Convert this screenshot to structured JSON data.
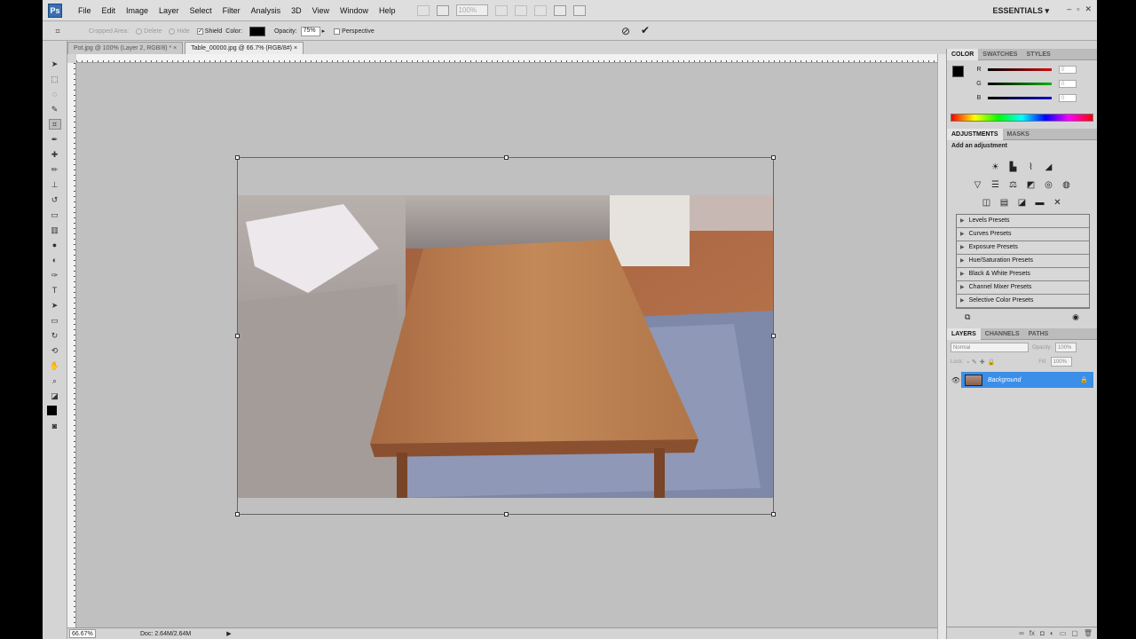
{
  "app": {
    "logo": "Ps",
    "workspace": "ESSENTIALS",
    "zoom_display": "100%"
  },
  "menu": [
    "File",
    "Edit",
    "Image",
    "Layer",
    "Select",
    "Filter",
    "Analysis",
    "3D",
    "View",
    "Window",
    "Help"
  ],
  "options": {
    "cropped_area": "Cropped Area:",
    "delete": "Delete",
    "hide": "Hide",
    "shield": "Shield",
    "color": "Color:",
    "opacity_label": "Opacity:",
    "opacity_value": "75%",
    "perspective": "Perspective"
  },
  "tabs": [
    {
      "label": "Pot.jpg @ 100% (Layer 2, RGB/8) *"
    },
    {
      "label": "Table_00000.jpg @ 66.7% (RGB/8#)"
    }
  ],
  "status": {
    "zoom": "66.67%",
    "doc": "Doc: 2.64M/2.64M"
  },
  "color_panel": {
    "tabs": [
      "COLOR",
      "SWATCHES",
      "STYLES"
    ],
    "channels": [
      {
        "label": "R",
        "value": "0",
        "color": "#d01010"
      },
      {
        "label": "G",
        "value": "0",
        "color": "#10b010"
      },
      {
        "label": "B",
        "value": "0",
        "color": "#1010d0"
      }
    ]
  },
  "adjustments": {
    "tabs": [
      "ADJUSTMENTS",
      "MASKS"
    ],
    "title": "Add an adjustment",
    "presets": [
      "Levels Presets",
      "Curves Presets",
      "Exposure Presets",
      "Hue/Saturation Presets",
      "Black & White Presets",
      "Channel Mixer Presets",
      "Selective Color Presets"
    ]
  },
  "layers": {
    "tabs": [
      "LAYERS",
      "CHANNELS",
      "PATHS"
    ],
    "blend_mode": "Normal",
    "opacity_label": "Opacity:",
    "opacity": "100%",
    "lock_label": "Lock:",
    "fill_label": "Fill:",
    "fill": "100%",
    "layer_name": "Background"
  }
}
